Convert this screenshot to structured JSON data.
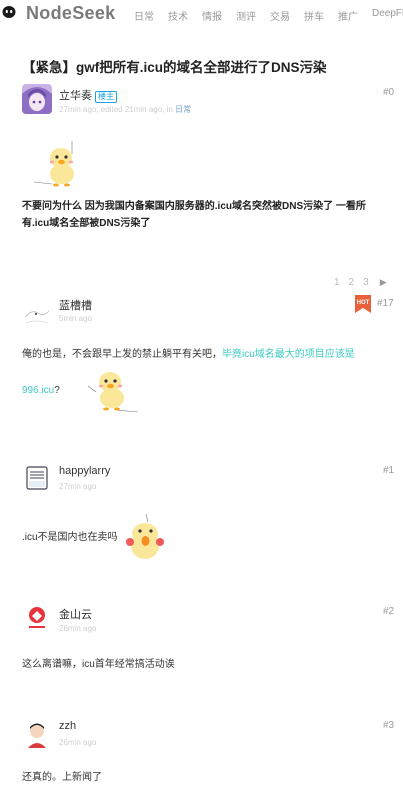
{
  "header": {
    "brand": "NodeSeek",
    "nav": [
      "日常",
      "技术",
      "情报",
      "测评",
      "交易",
      "拼车",
      "推广",
      "DeepFlood"
    ]
  },
  "post": {
    "title": "【紧急】gwf把所有.icu的域名全部进行了DNS污染"
  },
  "pagination": {
    "pages": [
      "1",
      "2",
      "3"
    ],
    "next": "▶"
  },
  "posts": [
    {
      "author": "立华奏",
      "badge": "楼主",
      "meta": "27min ago, edited 21min ago, in",
      "category": "日常",
      "floor": "#0",
      "text": "不要问为什么 因为我国内备案国内服务器的.icu域名突然被DNS污染了 一看所有.icu域名全部被DNS污染了"
    },
    {
      "author": "蓝槽槽",
      "meta": "5min ago",
      "floor": "#17",
      "text_line1_a": "俺的也是，不会跟早上发的禁止躺平有关吧，",
      "link_a": "毕竟icu域名最大的项目应该是",
      "link_b": "996.icu",
      "text_tail": "?"
    },
    {
      "author": "happylarry",
      "meta": "27min ago",
      "floor": "#1",
      "text": ".icu不是国内也在卖吗"
    },
    {
      "author": "金山云",
      "meta": "26min ago",
      "floor": "#2",
      "text": "这么离谱嘛，icu首年经常搞活动诶"
    },
    {
      "author": "zzh",
      "meta": "26min ago",
      "floor": "#3",
      "text": "还真的。上新闻了"
    }
  ]
}
